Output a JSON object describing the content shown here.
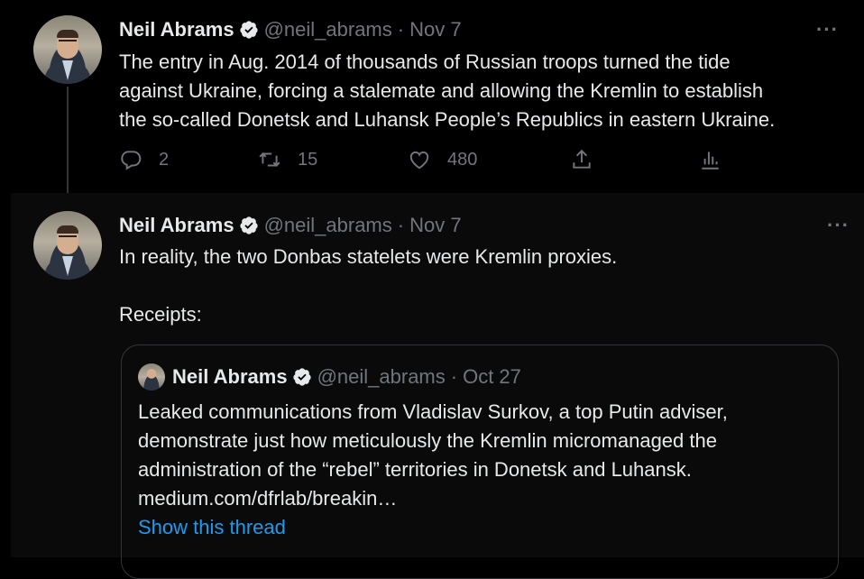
{
  "tweets": [
    {
      "author": "Neil Abrams",
      "handle": "@neil_abrams",
      "date": "Nov 7",
      "text": "The entry in Aug. 2014 of thousands of Russian troops turned the tide\nagainst Ukraine, forcing a stalemate and allowing the Kremlin to establish\nthe so-called Donetsk and Luhansk People’s Republics in eastern Ukraine.",
      "replies": "2",
      "retweets": "15",
      "likes": "480"
    },
    {
      "author": "Neil Abrams",
      "handle": "@neil_abrams",
      "date": "Nov 7",
      "text": "In reality, the two Donbas statelets were Kremlin proxies.\n\nReceipts:",
      "quote": {
        "author": "Neil Abrams",
        "handle": "@neil_abrams",
        "date": "Oct 27",
        "text": "Leaked communications from Vladislav Surkov, a top Putin adviser,\ndemonstrate just how meticulously the Kremlin micromanaged the\nadministration of the “rebel” territories in Donetsk and Luhansk.\nmedium.com/dfrlab/breakin…",
        "show_thread": "Show this thread"
      }
    }
  ],
  "separator": "·",
  "more_label": "···",
  "colors": {
    "background": "#000000",
    "text": "#e7e9ea",
    "muted": "#71767b",
    "link": "#1d9bf0",
    "verified": "#e7e9ea"
  },
  "icons": [
    "verified-badge-icon",
    "reply-icon",
    "retweet-icon",
    "like-icon",
    "share-icon",
    "analytics-icon",
    "more-icon"
  ]
}
